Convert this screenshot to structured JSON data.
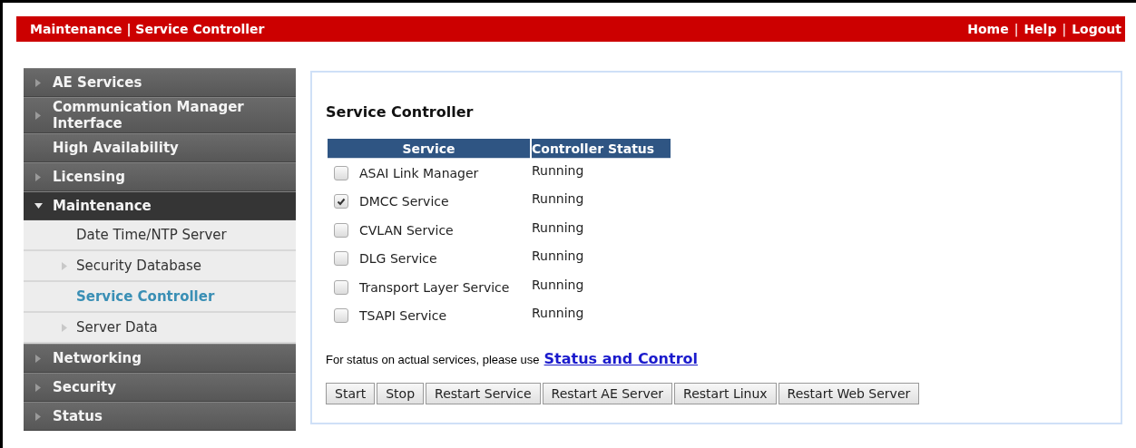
{
  "header": {
    "breadcrumb": "Maintenance | Service Controller",
    "nav": [
      {
        "kind": "link",
        "text": "Home"
      },
      {
        "kind": "separator",
        "text": "|"
      },
      {
        "kind": "link",
        "text": "Help"
      },
      {
        "kind": "separator",
        "text": "|"
      },
      {
        "kind": "link",
        "text": "Logout"
      }
    ]
  },
  "sidebar": {
    "items": [
      {
        "label": "AE Services",
        "kind": "group",
        "expanded": false
      },
      {
        "label": "Communication Manager Interface",
        "kind": "group",
        "expanded": false
      },
      {
        "label": "High Availability",
        "kind": "leaf"
      },
      {
        "label": "Licensing",
        "kind": "group",
        "expanded": false
      },
      {
        "label": "Maintenance",
        "kind": "group",
        "expanded": true,
        "children": [
          {
            "label": "Date Time/NTP Server",
            "kind": "leaf",
            "selected": false
          },
          {
            "label": "Security Database",
            "kind": "group",
            "selected": false
          },
          {
            "label": "Service Controller",
            "kind": "leaf",
            "selected": true
          },
          {
            "label": "Server Data",
            "kind": "group",
            "selected": false
          }
        ]
      },
      {
        "label": "Networking",
        "kind": "group",
        "expanded": false
      },
      {
        "label": "Security",
        "kind": "group",
        "expanded": false
      },
      {
        "label": "Status",
        "kind": "group",
        "expanded": false
      }
    ]
  },
  "content": {
    "title": "Service Controller",
    "table": {
      "columns": [
        "Service",
        "Controller Status"
      ],
      "rows": [
        {
          "service": "ASAI Link Manager",
          "status": "Running",
          "checked": false
        },
        {
          "service": "DMCC Service",
          "status": "Running",
          "checked": true
        },
        {
          "service": "CVLAN Service",
          "status": "Running",
          "checked": false
        },
        {
          "service": "DLG Service",
          "status": "Running",
          "checked": false
        },
        {
          "service": "Transport Layer Service",
          "status": "Running",
          "checked": false
        },
        {
          "service": "TSAPI Service",
          "status": "Running",
          "checked": false
        }
      ]
    },
    "note": "For status on actual services, please use",
    "note_link": "Status and Control",
    "buttons": [
      "Start",
      "Stop",
      "Restart Service",
      "Restart AE Server",
      "Restart Linux",
      "Restart Web Server"
    ]
  }
}
